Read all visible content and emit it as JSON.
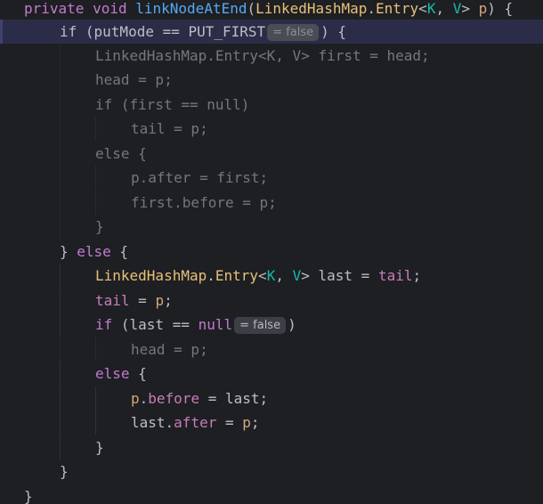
{
  "editor": {
    "lines": [
      [
        {
          "t": "private",
          "c": "kw2"
        },
        {
          "t": " ",
          "c": "plain"
        },
        {
          "t": "void",
          "c": "kw2"
        },
        {
          "t": " ",
          "c": "plain"
        },
        {
          "t": "linkNodeAtEnd",
          "c": "fn"
        },
        {
          "t": "(",
          "c": "paren"
        },
        {
          "t": "LinkedHashMap",
          "c": "ty"
        },
        {
          "t": ".",
          "c": "plain"
        },
        {
          "t": "Entry",
          "c": "ty"
        },
        {
          "t": "<",
          "c": "plain"
        },
        {
          "t": "K",
          "c": "tp"
        },
        {
          "t": ", ",
          "c": "plain"
        },
        {
          "t": "V",
          "c": "tp"
        },
        {
          "t": "> ",
          "c": "plain"
        },
        {
          "t": "p",
          "c": "param"
        },
        {
          "t": ") {",
          "c": "plain"
        }
      ],
      [
        {
          "t": "if",
          "c": "plain"
        },
        {
          "t": " (putMode == PUT_FIRST",
          "c": "plain"
        },
        {
          "hint": "= false",
          "faded": true
        },
        {
          "t": ") {",
          "c": "plain"
        }
      ],
      [
        {
          "t": "LinkedHashMap.Entry<K, V> first = head;",
          "c": "plain"
        }
      ],
      [
        {
          "t": "head = p;",
          "c": "plain"
        }
      ],
      [
        {
          "t": "if (first == null)",
          "c": "plain"
        }
      ],
      [
        {
          "t": "tail = p;",
          "c": "plain"
        }
      ],
      [
        {
          "t": "else {",
          "c": "plain"
        }
      ],
      [
        {
          "t": "p.after = first;",
          "c": "plain"
        }
      ],
      [
        {
          "t": "first.before = p;",
          "c": "plain"
        }
      ],
      [
        {
          "t": "}",
          "c": "plain"
        }
      ],
      [
        {
          "t": "} ",
          "c": "plain"
        },
        {
          "t": "else",
          "c": "kw2"
        },
        {
          "t": " {",
          "c": "plain"
        }
      ],
      [
        {
          "t": "LinkedHashMap",
          "c": "ty"
        },
        {
          "t": ".",
          "c": "plain"
        },
        {
          "t": "Entry",
          "c": "ty"
        },
        {
          "t": "<",
          "c": "plain"
        },
        {
          "t": "K",
          "c": "tp"
        },
        {
          "t": ", ",
          "c": "plain"
        },
        {
          "t": "V",
          "c": "tp"
        },
        {
          "t": "> last = ",
          "c": "plain"
        },
        {
          "t": "tail",
          "c": "field"
        },
        {
          "t": ";",
          "c": "plain"
        }
      ],
      [
        {
          "t": "tail",
          "c": "field"
        },
        {
          "t": " = ",
          "c": "plain"
        },
        {
          "t": "p",
          "c": "param"
        },
        {
          "t": ";",
          "c": "plain"
        }
      ],
      [
        {
          "t": "if",
          "c": "kw2"
        },
        {
          "t": " (last == ",
          "c": "plain"
        },
        {
          "t": "null",
          "c": "kw2"
        },
        {
          "hint": "= false",
          "faded": false
        },
        {
          "t": ")",
          "c": "plain"
        }
      ],
      [
        {
          "t": "head = p;",
          "c": "plain"
        }
      ],
      [
        {
          "t": "else",
          "c": "kw2"
        },
        {
          "t": " {",
          "c": "plain"
        }
      ],
      [
        {
          "t": "p",
          "c": "param"
        },
        {
          "t": ".",
          "c": "plain"
        },
        {
          "t": "before",
          "c": "field"
        },
        {
          "t": " = last;",
          "c": "plain"
        }
      ],
      [
        {
          "t": "last",
          "c": "plain"
        },
        {
          "t": ".",
          "c": "plain"
        },
        {
          "t": "after",
          "c": "field"
        },
        {
          "t": " = ",
          "c": "plain"
        },
        {
          "t": "p",
          "c": "param"
        },
        {
          "t": ";",
          "c": "plain"
        }
      ],
      [
        {
          "t": "}",
          "c": "plain"
        }
      ],
      [
        {
          "t": "}",
          "c": "plain"
        }
      ],
      [
        {
          "t": "}",
          "c": "plain"
        }
      ]
    ]
  }
}
